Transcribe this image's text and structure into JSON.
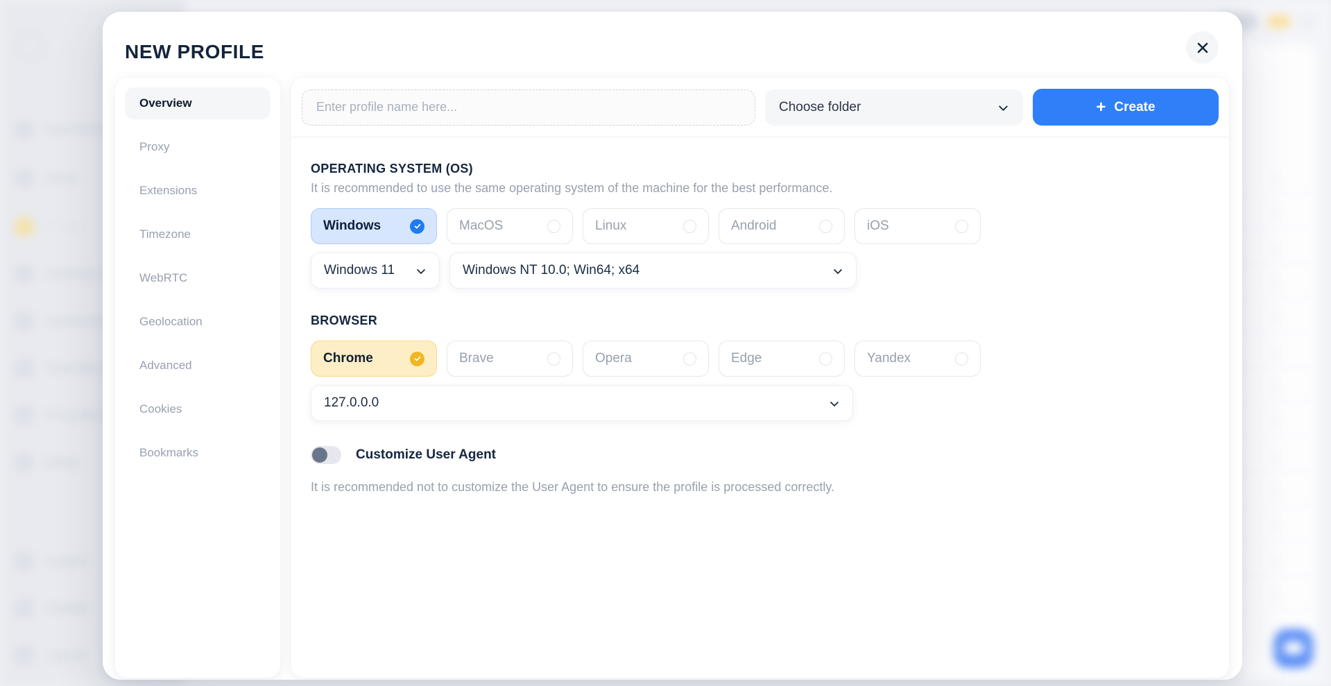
{
  "modal": {
    "title": "NEW PROFILE",
    "close_icon": "close-icon"
  },
  "sidebar": {
    "items": [
      {
        "label": "Overview"
      },
      {
        "label": "Proxy"
      },
      {
        "label": "Extensions"
      },
      {
        "label": "Timezone"
      },
      {
        "label": "WebRTC"
      },
      {
        "label": "Geolocation"
      },
      {
        "label": "Advanced"
      },
      {
        "label": "Cookies"
      },
      {
        "label": "Bookmarks"
      }
    ],
    "active": "Overview"
  },
  "toolbar": {
    "profile_name_value": "",
    "profile_name_placeholder": "Enter profile name here...",
    "folder_label": "Choose folder",
    "folder_chevron_icon": "chevron-down-icon",
    "create_label": "Create",
    "create_plus_icon": "plus-icon",
    "create_color": "#2f7ff8"
  },
  "os_section": {
    "title": "OPERATING SYSTEM (OS)",
    "description": "It is recommended to use the same operating system of the machine for the best performance.",
    "options": [
      {
        "label": "Windows",
        "selected": true
      },
      {
        "label": "MacOS",
        "selected": false
      },
      {
        "label": "Linux",
        "selected": false
      },
      {
        "label": "Android",
        "selected": false
      },
      {
        "label": "iOS",
        "selected": false
      }
    ],
    "selected_color": "#d6e6ff",
    "check_color": "#1e7bf2",
    "version_value": "Windows 11",
    "user_agent_value": "Windows NT 10.0; Win64; x64"
  },
  "browser_section": {
    "title": "BROWSER",
    "options": [
      {
        "label": "Chrome",
        "selected": true
      },
      {
        "label": "Brave",
        "selected": false
      },
      {
        "label": "Opera",
        "selected": false
      },
      {
        "label": "Edge",
        "selected": false
      },
      {
        "label": "Yandex",
        "selected": false
      }
    ],
    "selected_color": "#fdeec5",
    "check_color": "#f0b623",
    "version_value": "127.0.0.0"
  },
  "user_agent": {
    "toggle_label": "Customize User Agent",
    "toggle_on": false,
    "description": "It is recommended not to customize the User Agent to ensure the profile is processed correctly."
  },
  "background": {
    "nav_items": [
      {
        "label": "New Profile",
        "active": false
      },
      {
        "label": "Quick",
        "active": false
      },
      {
        "label": "Profiles",
        "active": true
      },
      {
        "label": "Automation",
        "active": false
      },
      {
        "label": "Synchronizer",
        "active": false
      },
      {
        "label": "Team Members",
        "active": false
      },
      {
        "label": "Proxy Manager",
        "active": false
      },
      {
        "label": "Billing",
        "active": false
      },
      {
        "label": "Support",
        "active": false
      },
      {
        "label": "Settings",
        "active": false
      },
      {
        "label": "Log out",
        "active": false
      }
    ],
    "table_badge_label": "Start"
  }
}
